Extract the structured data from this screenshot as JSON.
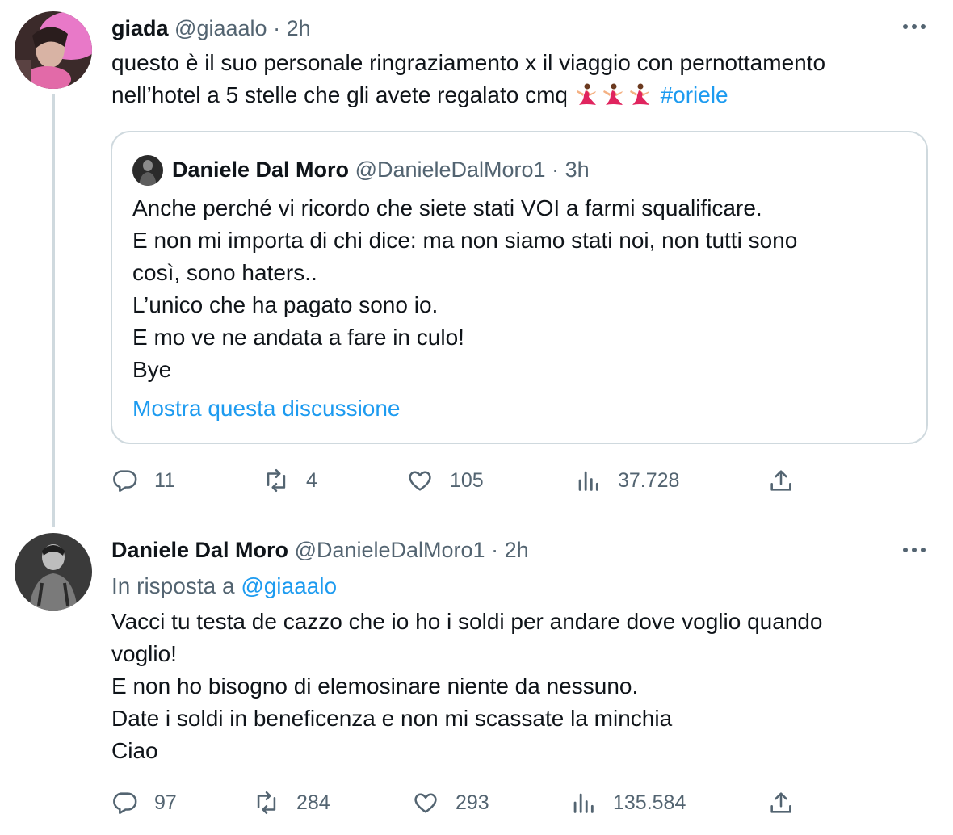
{
  "tweets": [
    {
      "author": {
        "name": "giada",
        "handle": "@giaaalo",
        "time": "2h"
      },
      "text_lines": [
        "questo è il suo personale ringraziamento x il viaggio con pernottamento",
        "nell’hotel a 5 stelle che gli avete regalato cmq"
      ],
      "emoji": [
        "dancer-emoji",
        "dancer-emoji",
        "dancer-emoji"
      ],
      "hashtag": "#oriele",
      "quote": {
        "author": {
          "name": "Daniele Dal Moro",
          "handle": "@DanieleDalMoro1",
          "time": "3h"
        },
        "lines": [
          "Anche perché vi ricordo che siete stati VOI a farmi squalificare.",
          "E non mi importa di chi dice: ma non siamo stati noi, non tutti sono",
          "così, sono haters..",
          "L’unico che ha pagato sono io.",
          "E mo ve ne andata a fare in culo!",
          "Bye"
        ],
        "show_thread": "Mostra questa discussione"
      },
      "stats": {
        "replies": "11",
        "retweets": "4",
        "likes": "105",
        "views": "37.728"
      }
    },
    {
      "author": {
        "name": "Daniele Dal Moro",
        "handle": "@DanieleDalMoro1",
        "time": "2h"
      },
      "reply_prefix": "In risposta a",
      "reply_mention": "@giaaalo",
      "lines": [
        "Vacci tu testa de cazzo che io ho i soldi per andare dove voglio quando",
        "voglio!",
        "E non ho bisogno di elemosinare niente da nessuno.",
        "Date i soldi in beneficenza e non mi scassate la minchia",
        "Ciao"
      ],
      "stats": {
        "replies": "97",
        "retweets": "284",
        "likes": "293",
        "views": "135.584"
      }
    }
  ],
  "separator": "·",
  "colors": {
    "text": "#0f1419",
    "secondary": "#536471",
    "link": "#1d9bf0",
    "border": "#cfd9de",
    "dancer": "#e0245e"
  },
  "icons": [
    "reply-icon",
    "retweet-icon",
    "like-icon",
    "views-icon",
    "share-icon",
    "more-icon"
  ]
}
